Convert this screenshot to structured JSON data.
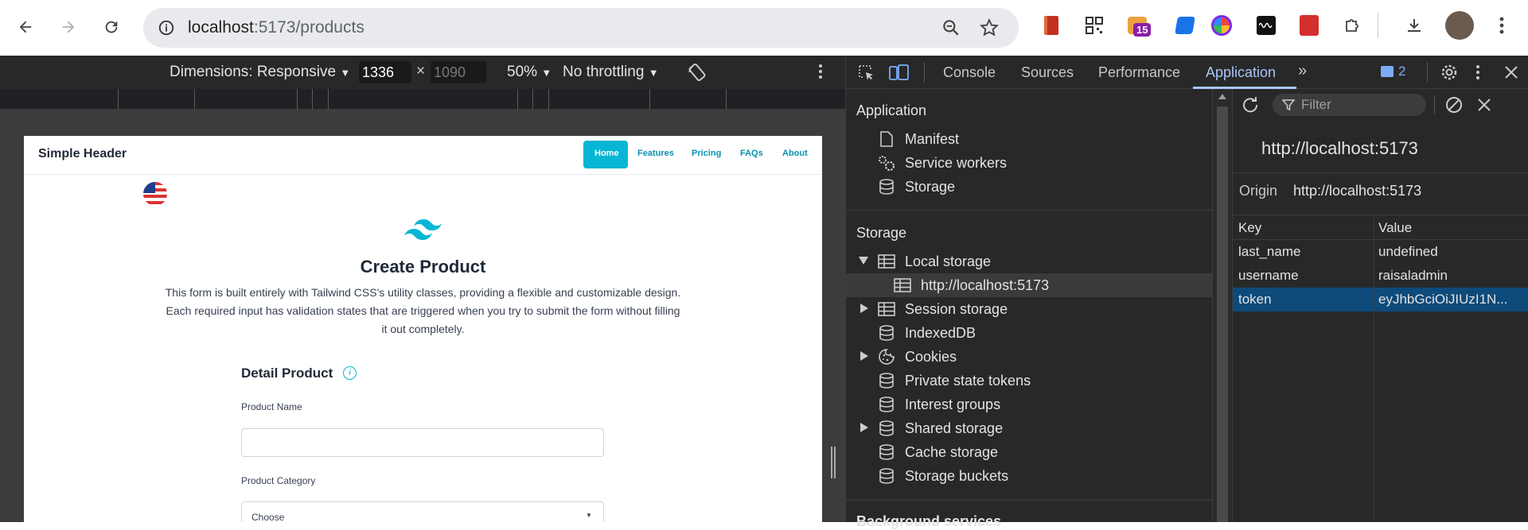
{
  "browser": {
    "url_host": "localhost",
    "url_path": ":5173/products",
    "ext_badge": "15"
  },
  "emulation": {
    "dimensions_label": "Dimensions: Responsive",
    "width_value": "1336",
    "height_placeholder": "1090",
    "times": "×",
    "zoom": "50%",
    "throttling": "No throttling"
  },
  "page": {
    "site_title": "Simple Header",
    "nav": [
      "Home",
      "Features",
      "Pricing",
      "FAQs",
      "About"
    ],
    "heading": "Create Product",
    "description_lines": [
      "This form is built entirely with Tailwind CSS's utility classes, providing a flexible and customizable design.",
      "Each required input has validation states that are triggered when you try to submit the form without filling",
      "it out completely."
    ],
    "section_title": "Detail Product",
    "info_glyph": "i",
    "product_name_label": "Product Name",
    "product_category_label": "Product Category",
    "category_selected": "Choose"
  },
  "devtools": {
    "tabs": [
      "Console",
      "Sources",
      "Performance",
      "Application"
    ],
    "active_tab": "Application",
    "issues_count": "2",
    "sidebar": {
      "application_title": "Application",
      "application_items": [
        "Manifest",
        "Service workers",
        "Storage"
      ],
      "storage_title": "Storage",
      "storage_items": [
        "Local storage",
        "http://localhost:5173",
        "Session storage",
        "IndexedDB",
        "Cookies",
        "Private state tokens",
        "Interest groups",
        "Shared storage",
        "Cache storage",
        "Storage buckets"
      ],
      "background_title": "Background services"
    },
    "main": {
      "filter_placeholder": "Filter",
      "origin_heading": "http://localhost:5173",
      "origin_label": "Origin",
      "origin_value": "http://localhost:5173",
      "columns": [
        "Key",
        "Value"
      ],
      "rows": [
        {
          "key": "last_name",
          "value": "undefined"
        },
        {
          "key": "username",
          "value": "raisaladmin"
        },
        {
          "key": "token",
          "value": "eyJhbGciOiJIUzI1N..."
        }
      ]
    }
  },
  "colors": {
    "accent": "#06b6d4",
    "selected_row": "#0e4a7a",
    "devtools_bg": "#282828"
  }
}
